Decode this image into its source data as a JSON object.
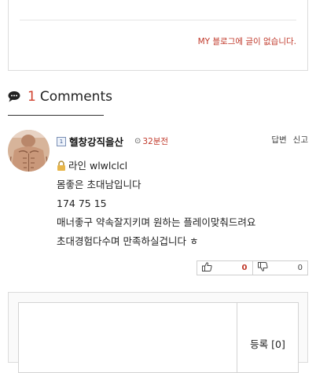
{
  "post": {
    "empty_blog_message": "MY 블로그에 글이 없습니다."
  },
  "comments": {
    "count": "1",
    "heading": "Comments"
  },
  "comment": {
    "level": "1",
    "author": "헬창강직을산",
    "time": "32분전",
    "reply_label": "답변",
    "report_label": "신고",
    "lines": [
      "라인 wlwlclcl",
      "몸좋은 초대남입니다",
      "174 75 15",
      "매너좋구 약속잘지키며 원하는 플레이맞춰드려요",
      "초대경험다수며 만족하실겁니다 ㅎ"
    ],
    "upvotes": "0",
    "downvotes": "0"
  },
  "form": {
    "submit_label": "등록 [0]"
  },
  "colors": {
    "accent": "#c0392b"
  }
}
